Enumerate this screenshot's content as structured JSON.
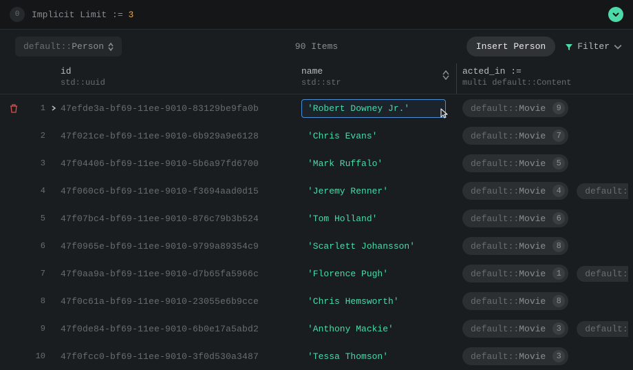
{
  "topbar": {
    "history_index": "0",
    "limit_label": "Implicit Limit :=",
    "limit_value": "3"
  },
  "toolbar": {
    "type_module": "default::",
    "type_name": "Person",
    "item_count": "90 Items",
    "insert_label": "Insert Person",
    "filter_label": "Filter"
  },
  "columns": {
    "id": {
      "label": "id",
      "type": "std::uuid"
    },
    "name": {
      "label": "name",
      "type": "std::str"
    },
    "acted_in": {
      "label": "acted_in :=",
      "type": "multi default::Content"
    }
  },
  "pill_label": "default::",
  "pill_type": "Movie",
  "pill_label_extra": "default:",
  "rows": [
    {
      "n": "1",
      "id": "47efde3a-bf69-11ee-9010-83129be9fa0b",
      "name": "'Robert Downey Jr.'",
      "count": "9",
      "overflow": false,
      "editing": true,
      "active": true
    },
    {
      "n": "2",
      "id": "47f021ce-bf69-11ee-9010-6b929a9e6128",
      "name": "'Chris Evans'",
      "count": "7",
      "overflow": false
    },
    {
      "n": "3",
      "id": "47f04406-bf69-11ee-9010-5b6a97fd6700",
      "name": "'Mark Ruffalo'",
      "count": "5",
      "overflow": false
    },
    {
      "n": "4",
      "id": "47f060c6-bf69-11ee-9010-f3694aad0d15",
      "name": "'Jeremy Renner'",
      "count": "4",
      "overflow": true
    },
    {
      "n": "5",
      "id": "47f07bc4-bf69-11ee-9010-876c79b3b524",
      "name": "'Tom Holland'",
      "count": "6",
      "overflow": false
    },
    {
      "n": "6",
      "id": "47f0965e-bf69-11ee-9010-9799a89354c9",
      "name": "'Scarlett Johansson'",
      "count": "8",
      "overflow": false
    },
    {
      "n": "7",
      "id": "47f0aa9a-bf69-11ee-9010-d7b65fa5966c",
      "name": "'Florence Pugh'",
      "count": "1",
      "overflow": true
    },
    {
      "n": "8",
      "id": "47f0c61a-bf69-11ee-9010-23055e6b9cce",
      "name": "'Chris Hemsworth'",
      "count": "8",
      "overflow": false
    },
    {
      "n": "9",
      "id": "47f0de84-bf69-11ee-9010-6b0e17a5abd2",
      "name": "'Anthony Mackie'",
      "count": "3",
      "overflow": true
    },
    {
      "n": "10",
      "id": "47f0fcc0-bf69-11ee-9010-3f0d530a3487",
      "name": "'Tessa Thomson'",
      "count": "3",
      "overflow": false
    }
  ]
}
